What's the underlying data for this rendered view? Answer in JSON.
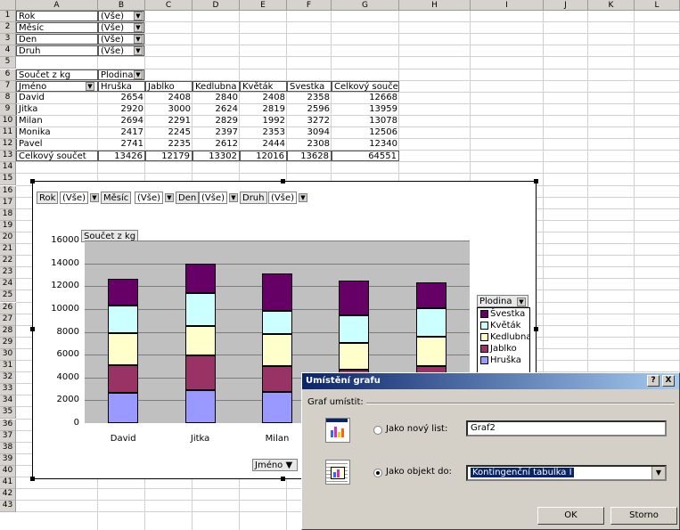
{
  "columns": [
    "A",
    "B",
    "C",
    "D",
    "E",
    "F",
    "G",
    "H",
    "I",
    "J",
    "K",
    "L"
  ],
  "rows": [
    "1",
    "2",
    "3",
    "4",
    "5",
    "6",
    "7",
    "8",
    "9",
    "10",
    "11",
    "12",
    "13",
    "14",
    "15",
    "16",
    "17",
    "18",
    "19",
    "20",
    "21",
    "22",
    "23",
    "24",
    "25",
    "26",
    "27",
    "28",
    "29",
    "30",
    "31",
    "32",
    "33",
    "34",
    "35",
    "36",
    "37",
    "38",
    "39",
    "40",
    "41",
    "42",
    "43"
  ],
  "page_fields": [
    {
      "label": "Rok",
      "value": "(Vše)"
    },
    {
      "label": "Měsíc",
      "value": "(Vše)"
    },
    {
      "label": "Den",
      "value": "(Vše)"
    },
    {
      "label": "Druh",
      "value": "(Vše)"
    }
  ],
  "pivot": {
    "data_label": "Součet z kg",
    "col_field": "Plodina",
    "row_field": "Jméno",
    "headers": [
      "Hruška",
      "Jablko",
      "Kedlubna",
      "Květák",
      "Švestka",
      "Celkový součet"
    ],
    "rows": [
      {
        "name": "David",
        "vals": [
          "2654",
          "2408",
          "2840",
          "2408",
          "2358",
          "12668"
        ]
      },
      {
        "name": "Jitka",
        "vals": [
          "2920",
          "3000",
          "2624",
          "2819",
          "2596",
          "13959"
        ]
      },
      {
        "name": "Milan",
        "vals": [
          "2694",
          "2291",
          "2829",
          "1992",
          "3272",
          "13078"
        ]
      },
      {
        "name": "Monika",
        "vals": [
          "2417",
          "2245",
          "2397",
          "2353",
          "3094",
          "12506"
        ]
      },
      {
        "name": "Pavel",
        "vals": [
          "2741",
          "2235",
          "2612",
          "2444",
          "2308",
          "12340"
        ]
      }
    ],
    "total": {
      "name": "Celkový součet",
      "vals": [
        "13426",
        "12179",
        "13302",
        "12016",
        "13628",
        "64551"
      ]
    }
  },
  "chart_page_fields": [
    {
      "label": "Rok",
      "value": "(Vše)"
    },
    {
      "label": "Měsíc",
      "value": "(Vše)"
    },
    {
      "label": "Den",
      "value": "(Vše)"
    },
    {
      "label": "Druh",
      "value": "(Vše)"
    }
  ],
  "chart_data": {
    "type": "bar",
    "stacked": true,
    "data_field_button": "Součet z kg",
    "categories": [
      "David",
      "Jitka",
      "Milan",
      "Monika",
      "Pavel"
    ],
    "visible_category_labels": [
      "David",
      "Jitka",
      "Milan"
    ],
    "series": [
      {
        "name": "Hruška",
        "color": "#9999ff",
        "values": [
          2654,
          2920,
          2694,
          2417,
          2741
        ]
      },
      {
        "name": "Jablko",
        "color": "#993366",
        "values": [
          2408,
          3000,
          2291,
          2245,
          2235
        ]
      },
      {
        "name": "Kedlubna",
        "color": "#ffffcc",
        "values": [
          2840,
          2624,
          2829,
          2397,
          2612
        ]
      },
      {
        "name": "Květák",
        "color": "#ccffff",
        "values": [
          2408,
          2819,
          1992,
          2353,
          2444
        ]
      },
      {
        "name": "Švestka",
        "color": "#660066",
        "values": [
          2358,
          2596,
          3272,
          3094,
          2308
        ]
      }
    ],
    "legend_order": [
      "Švestka",
      "Květák",
      "Kedlubna",
      "Jablko",
      "Hruška"
    ],
    "legend_title": "Plodina",
    "category_field_button": "Jméno",
    "ylim": [
      0,
      16000
    ],
    "yticks": [
      "0",
      "2000",
      "4000",
      "6000",
      "8000",
      "10000",
      "12000",
      "14000",
      "16000"
    ],
    "grid": true,
    "legend_position": "right"
  },
  "dialog": {
    "title": "Umístění grafu",
    "help": "?",
    "close": "X",
    "group_label": "Graf umístit:",
    "option_new_sheet": "Jako nový list:",
    "option_new_sheet_value": "Graf2",
    "option_object": "Jako objekt do:",
    "option_object_value": "Kontingenční tabulka I",
    "ok": "OK",
    "cancel": "Storno"
  },
  "icons": {
    "dropdown": "▼",
    "chart": "chart-icon",
    "object": "sheet-chart-icon"
  }
}
